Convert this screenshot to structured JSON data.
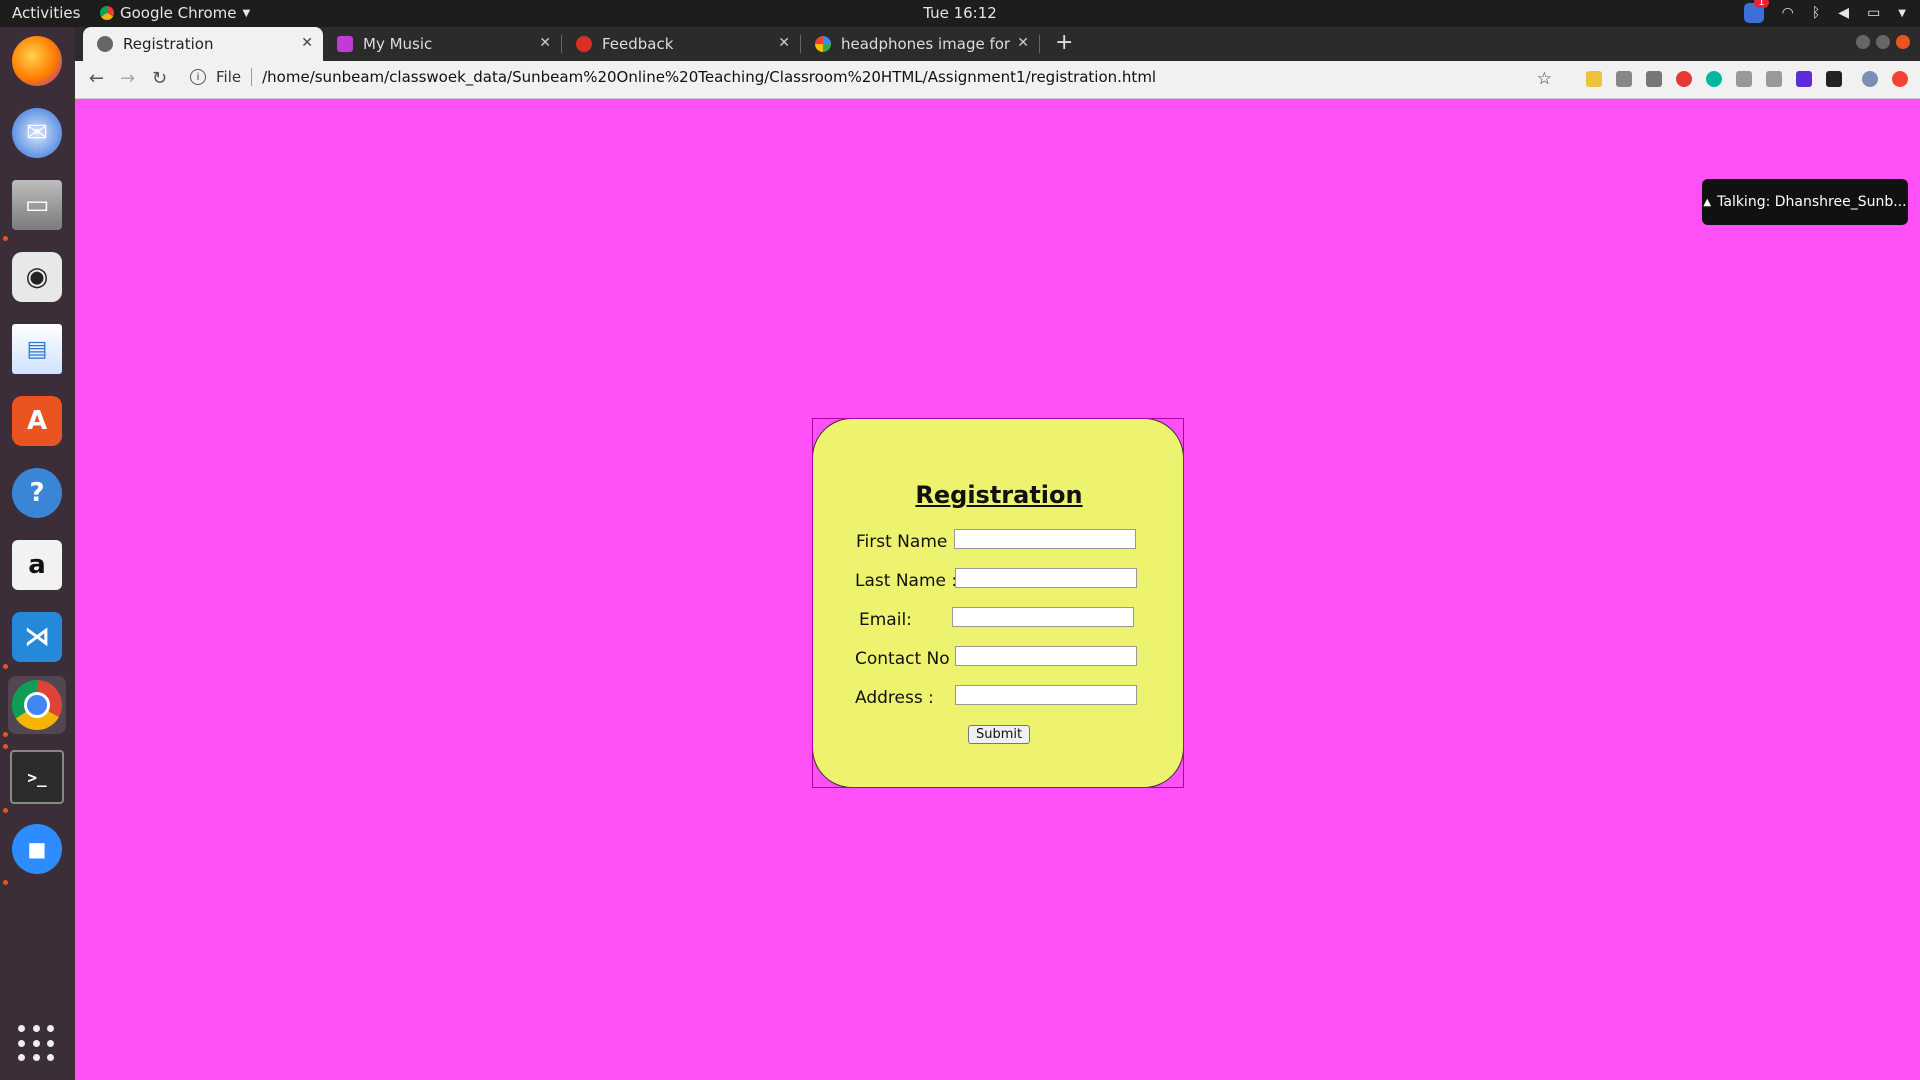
{
  "system": {
    "activities": "Activities",
    "app_name": "Google Chrome",
    "clock": "Tue 16:12",
    "notification_count": "1"
  },
  "dock": {
    "items": [
      {
        "name": "firefox-icon",
        "color": "#ff7b00"
      },
      {
        "name": "thunderbird-icon",
        "color": "#2d6fd6"
      },
      {
        "name": "files-icon",
        "color": "#8a8a8a"
      },
      {
        "name": "rhythmbox-icon",
        "color": "#f5c400"
      },
      {
        "name": "libreoffice-writer-icon",
        "color": "#2a78d6"
      },
      {
        "name": "ubuntu-software-icon",
        "color": "#e95420"
      },
      {
        "name": "help-icon",
        "color": "#3b85d6"
      },
      {
        "name": "amazon-icon",
        "color": "#f2f2f2"
      },
      {
        "name": "vscode-icon",
        "color": "#2489d8"
      },
      {
        "name": "chrome-icon",
        "color": "#db4437"
      },
      {
        "name": "terminal-icon",
        "color": "#2c2c2c"
      },
      {
        "name": "zoom-icon",
        "color": "#2d8cff"
      }
    ]
  },
  "browser": {
    "tabs": [
      {
        "label": "Registration",
        "active": true,
        "icon_color": "#555555"
      },
      {
        "label": "My Music",
        "active": false,
        "icon_color": "#c23ad8"
      },
      {
        "label": "Feedback",
        "active": false,
        "icon_color": "#d93025"
      },
      {
        "label": "headphones image for de",
        "active": false,
        "icon_color": "#4285f4"
      }
    ],
    "new_tab": "+",
    "url_scheme": "File",
    "url": "/home/sunbeam/classwoek_data/Sunbeam%20Online%20Teaching/Classroom%20HTML/Assignment1/registration.html"
  },
  "page": {
    "background": "#ff4ff7",
    "card_color": "#eef36f",
    "title": "Registration",
    "fields": [
      {
        "label": "First Name :",
        "value": ""
      },
      {
        "label": "Last Name :",
        "value": ""
      },
      {
        "label": "Email:",
        "value": ""
      },
      {
        "label": "Contact No :",
        "value": ""
      },
      {
        "label": "Address :",
        "value": ""
      }
    ],
    "submit_label": "Submit"
  },
  "zoom_toast": {
    "text": "Talking: Dhanshree_Sunb..."
  }
}
